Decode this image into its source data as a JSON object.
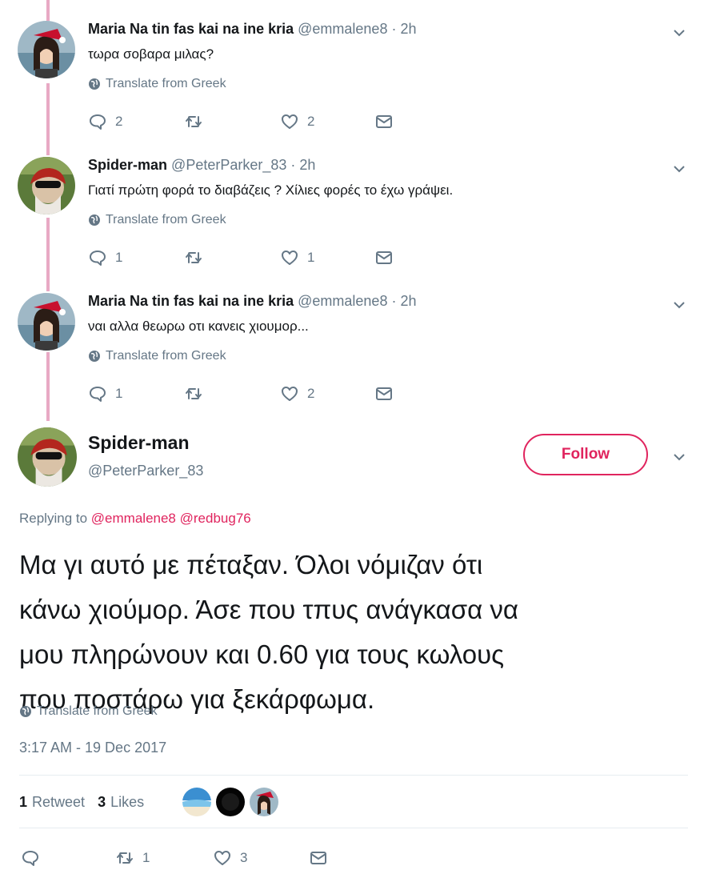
{
  "replies": [
    {
      "name": "Maria Na tin fas kai na ine kria",
      "handle": "@emmalene8",
      "time": "2h",
      "text": "τωρα σοβαρα μιλας?",
      "translate": "Translate from Greek",
      "reply_count": "2",
      "retweet_count": "",
      "like_count": "2"
    },
    {
      "name": "Spider-man",
      "handle": "@PeterParker_83",
      "time": "2h",
      "text": "Γιατί πρώτη φορά το διαβάζεις ? Χίλιες φορές το έχω γράψει.",
      "translate": "Translate from Greek",
      "reply_count": "1",
      "retweet_count": "",
      "like_count": "1"
    },
    {
      "name": "Maria Na tin fas kai na ine kria",
      "handle": "@emmalene8",
      "time": "2h",
      "text": "ναι αλλα θεωρω οτι κανεις χιουμορ...",
      "translate": "Translate from Greek",
      "reply_count": "1",
      "retweet_count": "",
      "like_count": "2"
    }
  ],
  "main_tweet": {
    "name": "Spider-man",
    "handle": "@PeterParker_83",
    "follow_label": "Follow",
    "replying_prefix": "Replying to",
    "replying_to": [
      "@emmalene8",
      "@redbug76"
    ],
    "text_lines": [
      "Μα γι αυτό με πέταξαν. Όλοι νόμιζαν ότι",
      "κάνω χιούμορ. Άσε που τπυς ανάγκασα να",
      "μου πληρώνουν και 0.60 για τους κωλους",
      "που ποστάρω για ξεκάρφωμα."
    ],
    "translate": "Translate from Greek",
    "timestamp": "3:17 AM - 19 Dec 2017",
    "retweets_count": "1",
    "retweets_label": "Retweet",
    "likes_count": "3",
    "likes_label": "Likes",
    "reply_count": "",
    "retweet_action_count": "1",
    "like_action_count": "3"
  },
  "colors": {
    "accent": "#e0245e",
    "thread_line": "#e8a9c4",
    "muted": "#657786",
    "text": "#14171a"
  },
  "icons": [
    "globe-icon",
    "chevron-down-icon",
    "reply-icon",
    "retweet-icon",
    "heart-icon",
    "message-icon"
  ]
}
